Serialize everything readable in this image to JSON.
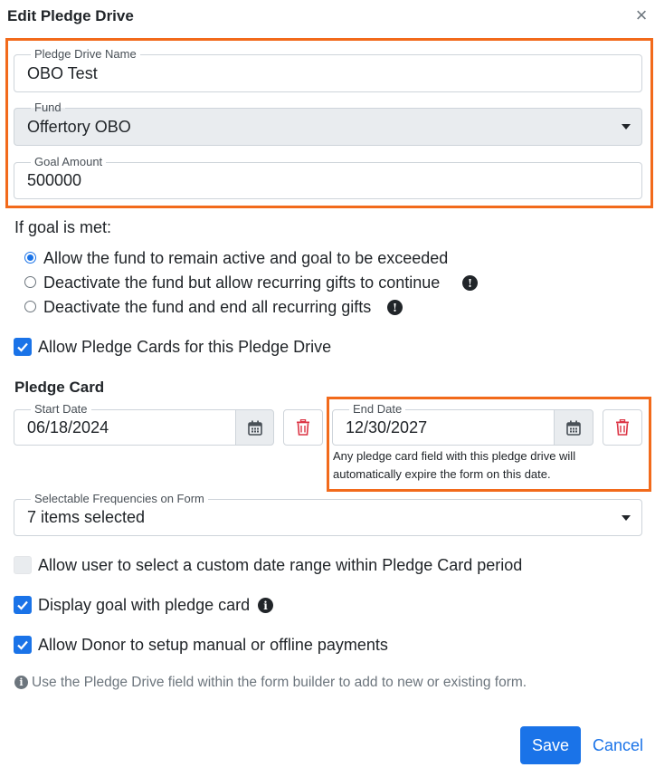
{
  "dialog": {
    "title": "Edit Pledge Drive",
    "close_glyph": "×"
  },
  "fields": {
    "name": {
      "label": "Pledge Drive Name",
      "value": "OBO Test"
    },
    "fund": {
      "label": "Fund",
      "value": "Offertory OBO"
    },
    "goal": {
      "label": "Goal Amount",
      "value": "500000"
    }
  },
  "goal_section": {
    "heading": "If goal is met:",
    "options": [
      {
        "label": "Allow the fund to remain active and goal to be exceeded",
        "selected": true
      },
      {
        "label": "Deactivate the fund but allow recurring gifts to continue",
        "selected": false
      },
      {
        "label": "Deactivate the fund and end all recurring gifts",
        "selected": false
      }
    ]
  },
  "allow_pledge_cards": {
    "label": "Allow Pledge Cards for this Pledge Drive",
    "checked": true
  },
  "pledge_card": {
    "heading": "Pledge Card",
    "start_date": {
      "label": "Start Date",
      "value": "06/18/2024"
    },
    "end_date": {
      "label": "End Date",
      "value": "12/30/2027"
    },
    "end_help": "Any pledge card field with this pledge drive will automatically expire the form on this date."
  },
  "frequencies": {
    "label": "Selectable Frequencies on Form",
    "value": "7 items selected"
  },
  "checkboxes": {
    "custom_range": {
      "label": "Allow user to select a custom date range within Pledge Card period",
      "checked": false
    },
    "display_goal": {
      "label": "Display goal with pledge card",
      "checked": true
    },
    "manual_payments": {
      "label": "Allow Donor to setup manual or offline payments",
      "checked": true
    }
  },
  "note": "Use the Pledge Drive field within the form builder to add to new or existing form.",
  "footer": {
    "save_label": "Save",
    "cancel_label": "Cancel"
  },
  "colors": {
    "accent": "#1a73e8",
    "highlight": "#f26a1b",
    "danger": "#dc3545"
  },
  "icons": [
    "close-icon",
    "info-icon",
    "calendar-icon",
    "trash-icon",
    "check-icon",
    "chevron-down-icon"
  ]
}
